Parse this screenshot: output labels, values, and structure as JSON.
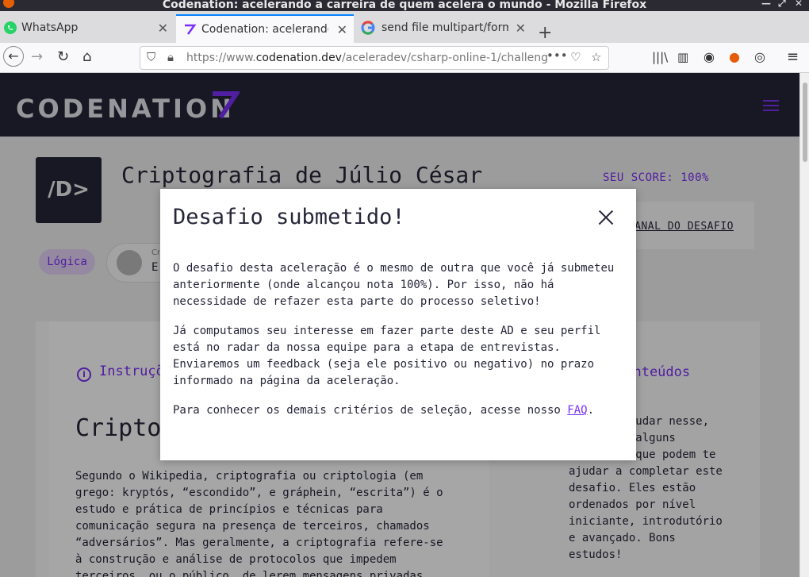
{
  "window": {
    "title": "Codenation: acelerando a carreira de quem acelera o mundo - Mozilla Firefox"
  },
  "tabs": [
    {
      "label": "WhatsApp",
      "favicon": "whatsapp-icon"
    },
    {
      "label": "Codenation: acelerando a",
      "favicon": "codenation-icon",
      "active": true
    },
    {
      "label": "send file multipart/form-",
      "favicon": "google-icon"
    }
  ],
  "navbar": {
    "url_prefix": "https://www.",
    "url_domain": "codenation.dev",
    "url_path": "/aceleradev/csharp-online-1/challenge"
  },
  "site": {
    "logo_text": "CODENATION",
    "challenge_icon_text": "/D>",
    "challenge_title": "Criptografia de Júlio César",
    "score": "SEU SCORE: 100%",
    "canal_link": "CANAL DO DESAFIO",
    "tag": "Lógica",
    "author_caption": "Cr",
    "author_name": "E",
    "instructions_heading": "Instruções",
    "contents_heading": "Conteúdos",
    "section_title": "Criptografia",
    "body_text": "Segundo o Wikipedia, criptografia ou criptologia (em grego: kryptós, “escondido”, e gráphein, “escrita”) é o estudo e prática de princípios e técnicas para comunicação segura na presença de terceiros, chamados “adversários”. Mas geralmente, a criptografia refere-se à construção e análise de protocolos que impedem terceiros, ou o público, de lerem mensagens privadas.",
    "side_text": "Para te ajudar nesse, separamos alguns conteúdos que podem te ajudar a completar este desafio. Eles estão ordenados por nível iniciante, introdutório e avançado. Bons estudos!"
  },
  "modal": {
    "title": "Desafio submetido!",
    "paragraph1": "O desafio desta aceleração é o mesmo de outra que você já submeteu anteriormente (onde alcançou nota 100%). Por isso, não há necessidade de refazer esta parte do processo seletivo!",
    "paragraph2": "Já computamos seu interesse em fazer parte deste AD e seu perfil está no radar da nossa equipe para a etapa de entrevistas. Enviaremos um feedback (seja ele positivo ou negativo) no prazo informado na página da aceleração.",
    "paragraph3_prefix": "Para conhecer os demais critérios de seleção, acesse nosso ",
    "faq_link": "FAQ",
    "paragraph3_suffix": "."
  },
  "colors": {
    "brand_purple": "#7b2ff7",
    "header_dark": "#26263a"
  }
}
